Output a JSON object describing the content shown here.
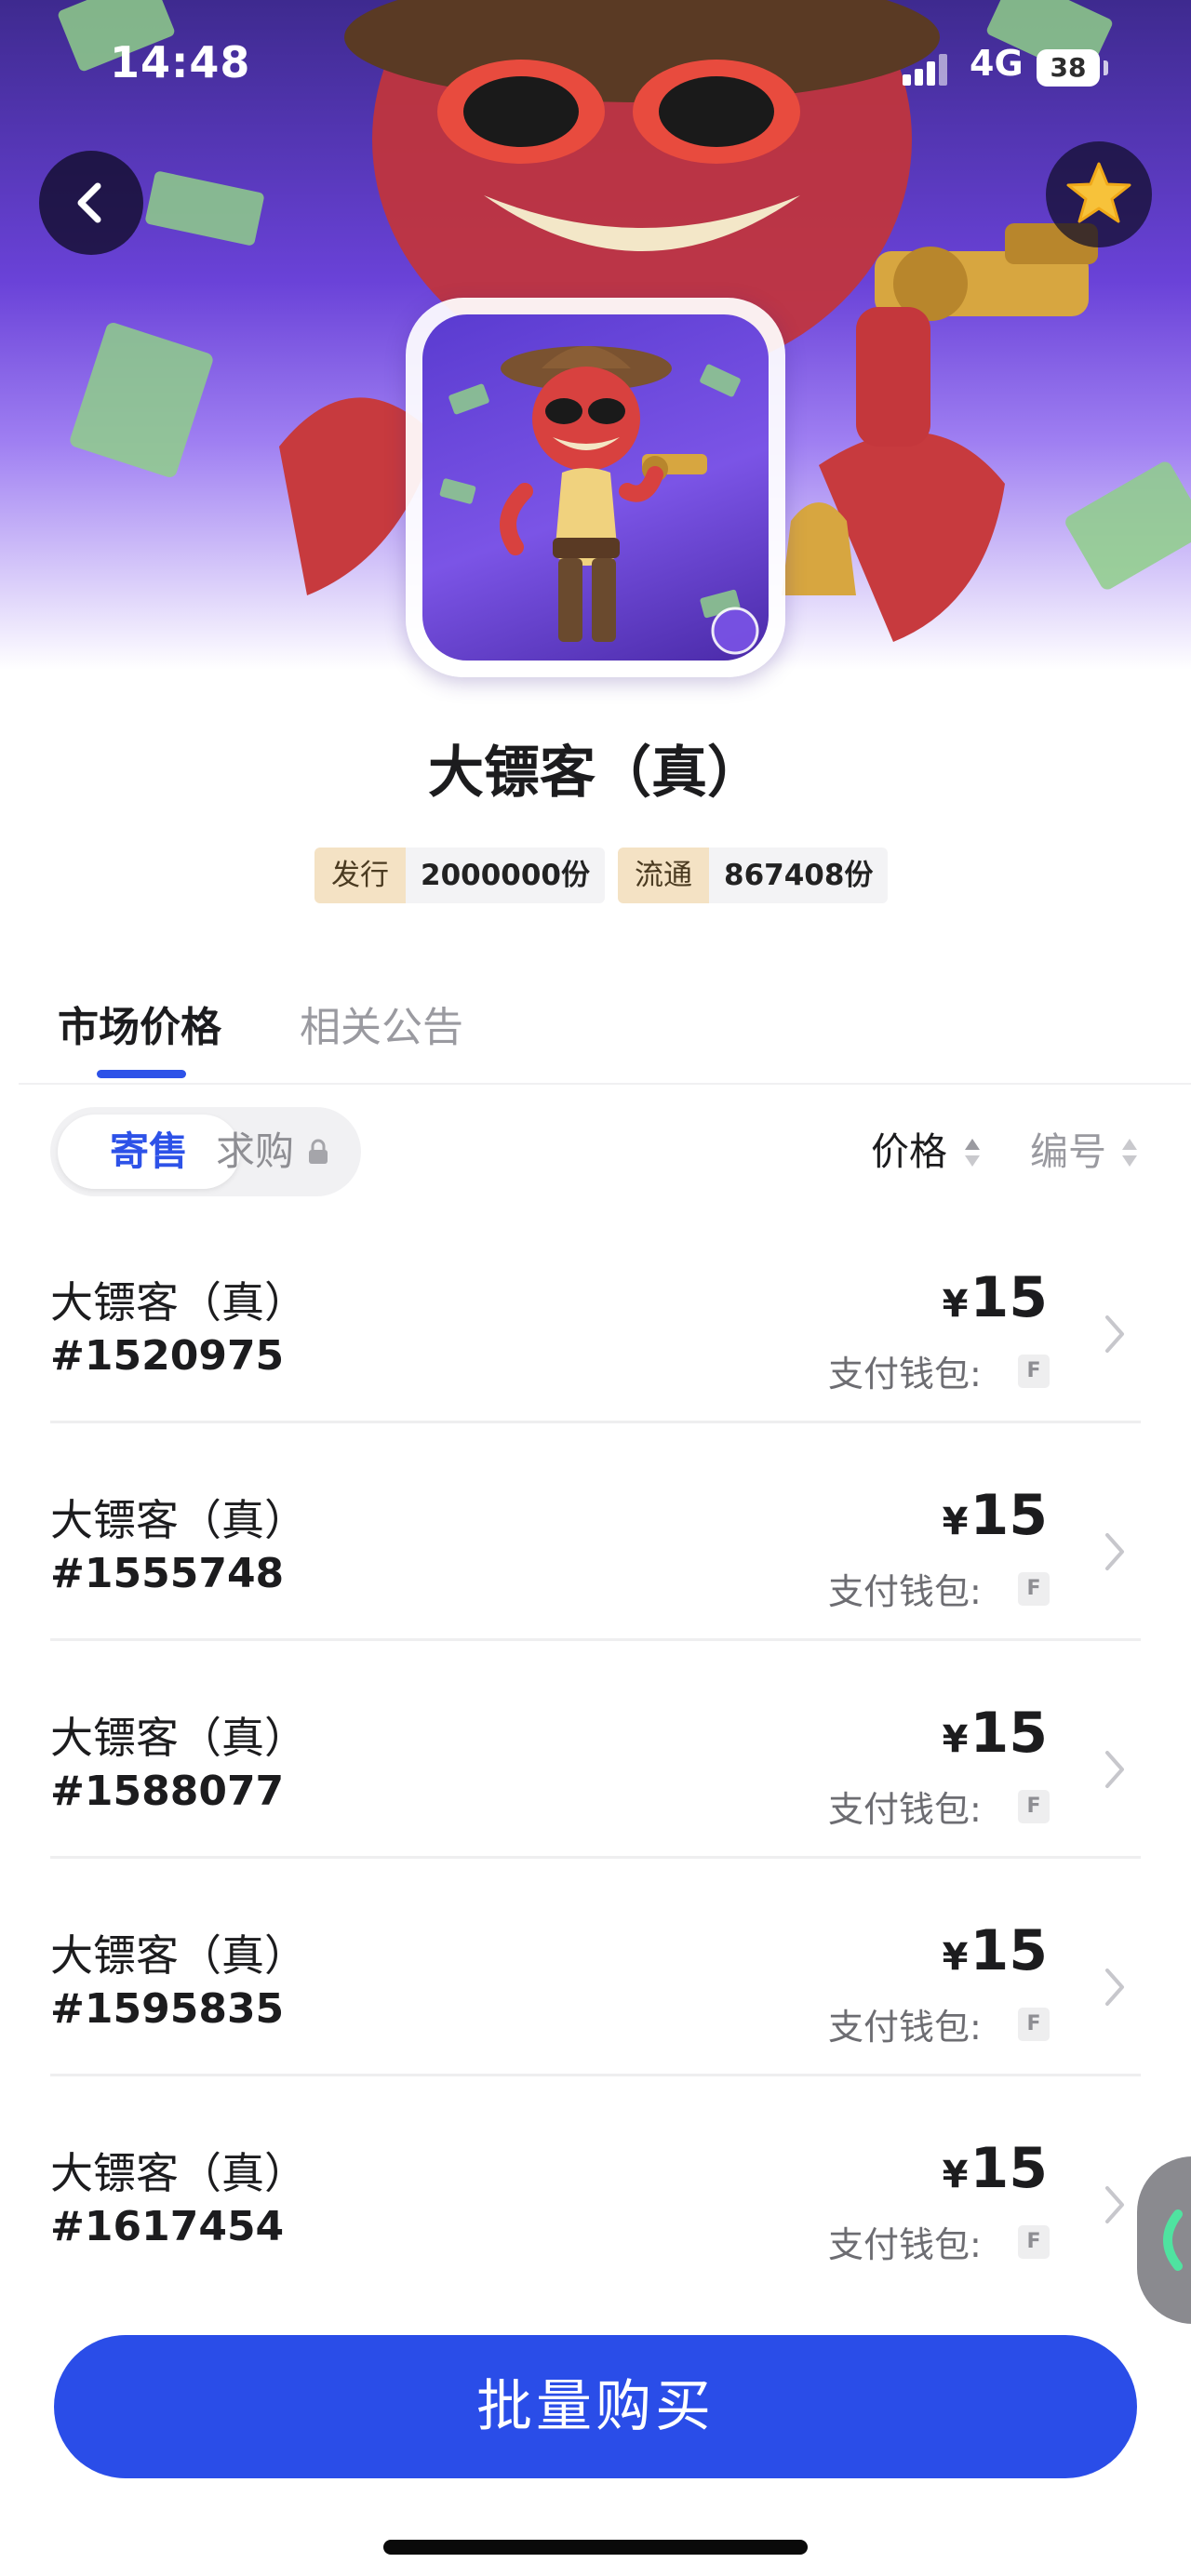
{
  "status_bar": {
    "time": "14:48",
    "network": "4G",
    "battery": "38"
  },
  "collection": {
    "title": "大镖客（真）",
    "issued_label": "发行",
    "issued_value": "2000000份",
    "circulating_label": "流通",
    "circulating_value": "867408份"
  },
  "tabs": [
    {
      "label": "市场价格",
      "active": true
    },
    {
      "label": "相关公告",
      "active": false
    }
  ],
  "segment": {
    "on_sale": "寄售",
    "wanted": "求购"
  },
  "sort": {
    "price": "价格",
    "number": "编号"
  },
  "listings": [
    {
      "name": "大镖客（真）",
      "number": "#1520975",
      "currency": "¥",
      "price": "15",
      "wallet_label": "支付钱包:",
      "wallet": "F"
    },
    {
      "name": "大镖客（真）",
      "number": "#1555748",
      "currency": "¥",
      "price": "15",
      "wallet_label": "支付钱包:",
      "wallet": "F"
    },
    {
      "name": "大镖客（真）",
      "number": "#1588077",
      "currency": "¥",
      "price": "15",
      "wallet_label": "支付钱包:",
      "wallet": "F"
    },
    {
      "name": "大镖客（真）",
      "number": "#1595835",
      "currency": "¥",
      "price": "15",
      "wallet_label": "支付钱包:",
      "wallet": "F"
    },
    {
      "name": "大镖客（真）",
      "number": "#1617454",
      "currency": "¥",
      "price": "15",
      "wallet_label": "支付钱包:",
      "wallet": "F"
    }
  ],
  "cta": {
    "label": "批量购买"
  },
  "colors": {
    "accent": "#2a4de8",
    "chip_bg": "#f4e2c4",
    "hero_purple": "#6a42d8"
  },
  "icons": {
    "back": "chevron-left-icon",
    "favorite": "star-icon",
    "row": "chevron-right-icon",
    "lock": "lock-icon"
  }
}
